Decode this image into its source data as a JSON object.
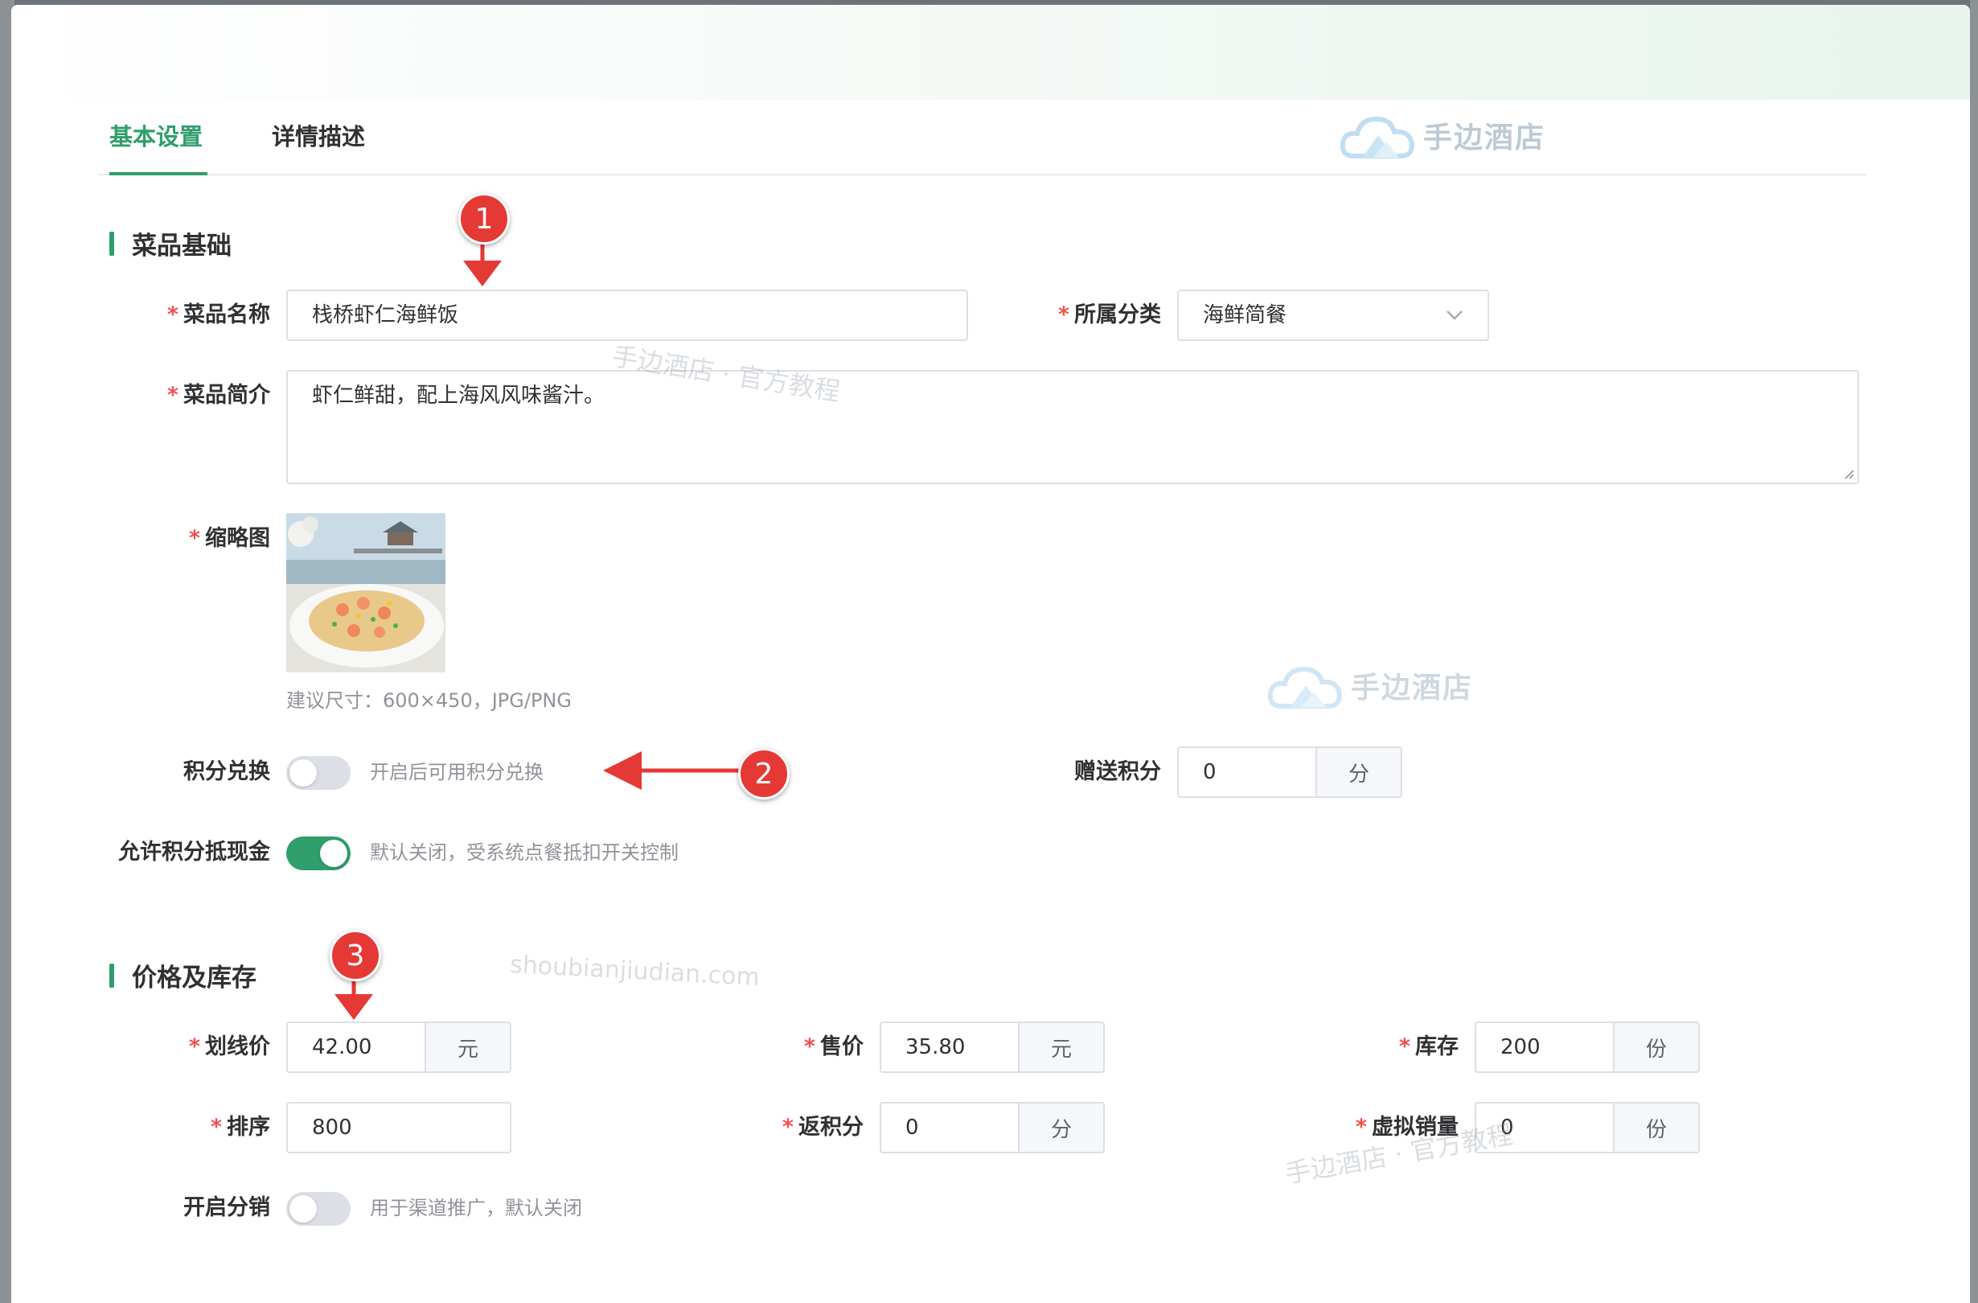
{
  "tabs": [
    {
      "label": "基本设置",
      "active": true
    },
    {
      "label": "详情描述",
      "active": false
    }
  ],
  "brand": {
    "name": "手边酒店"
  },
  "sections": {
    "basic": "菜品基础",
    "price": "价格及库存"
  },
  "form": {
    "dish_name": {
      "label": "菜品名称",
      "value": "栈桥虾仁海鲜饭",
      "required": true
    },
    "category": {
      "label": "所属分类",
      "value": "海鲜简餐",
      "required": true
    },
    "intro": {
      "label": "菜品简介",
      "value": "虾仁鲜甜，配上海风风味酱汁。",
      "required": true
    },
    "thumbnail": {
      "label": "缩略图",
      "hint": "建议尺寸：600×450，JPG/PNG",
      "required": true
    },
    "points_exchange": {
      "label": "积分兑换",
      "hint": "开启后可用积分兑换",
      "on": false
    },
    "gift_points": {
      "label": "赠送积分",
      "value": "0",
      "unit": "分"
    },
    "allow_points_cash": {
      "label": "允许积分抵现金",
      "hint": "默认关闭，受系统点餐抵扣开关控制",
      "on": true
    },
    "list_price": {
      "label": "划线价",
      "value": "42.00",
      "unit": "元",
      "required": true
    },
    "sale_price": {
      "label": "售价",
      "value": "35.80",
      "unit": "元",
      "required": true
    },
    "stock": {
      "label": "库存",
      "value": "200",
      "unit": "份",
      "required": true
    },
    "sort": {
      "label": "排序",
      "value": "800",
      "required": true
    },
    "rebate_points": {
      "label": "返积分",
      "value": "0",
      "unit": "分",
      "required": true
    },
    "virtual_sales": {
      "label": "虚拟销量",
      "value": "0",
      "unit": "份",
      "required": true
    },
    "distribution": {
      "label": "开启分销",
      "hint": "用于渠道推广，默认关闭",
      "on": false
    }
  },
  "watermarks": {
    "tutorial": "手边酒店 · 官方教程",
    "site": "shoubianjiudian.com"
  },
  "markers": [
    "1",
    "2",
    "3"
  ],
  "colors": {
    "accent": "#2f9e6b",
    "required": "#f0504f",
    "marker": "#e53935"
  }
}
